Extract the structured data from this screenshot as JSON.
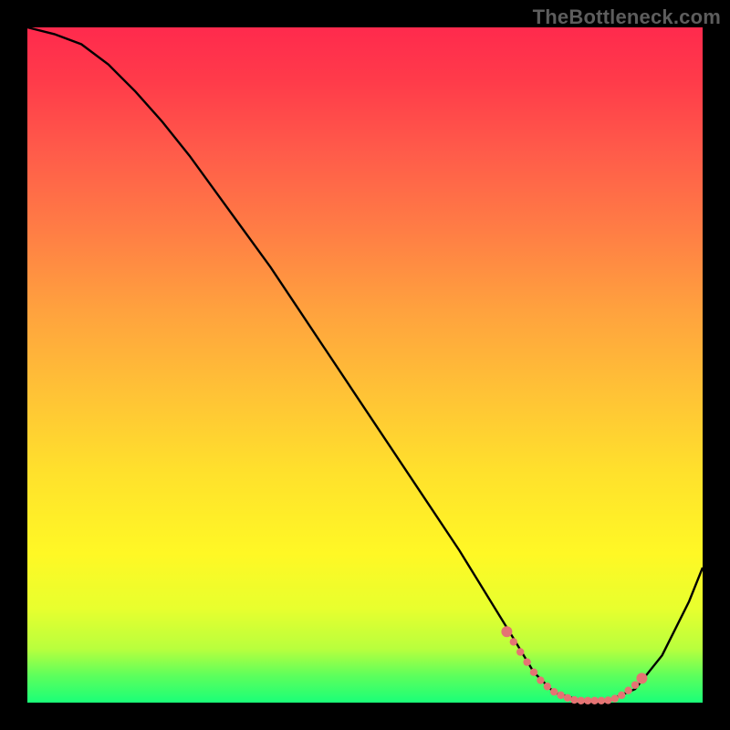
{
  "watermark": "TheBottleneck.com",
  "colors": {
    "frame": "#000000",
    "marker": "#e57373",
    "curve": "#000000",
    "gradient_top": "#ff2a4d",
    "gradient_bottom": "#1aff78"
  },
  "chart_data": {
    "type": "line",
    "title": "",
    "xlabel": "",
    "ylabel": "",
    "xlim": [
      0,
      100
    ],
    "ylim": [
      0,
      100
    ],
    "series": [
      {
        "name": "bottleneck-curve",
        "x": [
          0,
          4,
          8,
          12,
          16,
          20,
          24,
          28,
          32,
          36,
          40,
          44,
          48,
          52,
          56,
          60,
          64,
          68,
          72,
          75,
          78,
          82,
          86,
          90,
          94,
          98,
          100
        ],
        "y": [
          100,
          99,
          97.5,
          94.5,
          90.5,
          86,
          81,
          75.5,
          70,
          64.5,
          58.5,
          52.5,
          46.5,
          40.5,
          34.5,
          28.5,
          22.5,
          16,
          9.5,
          4.5,
          1.5,
          0.3,
          0.3,
          2,
          7,
          15,
          20
        ]
      }
    ],
    "markers": {
      "name": "highlight-range",
      "x": [
        71,
        72,
        73,
        74,
        75,
        76,
        77,
        78,
        79,
        80,
        81,
        82,
        83,
        84,
        85,
        86,
        87,
        88,
        89,
        90,
        91
      ],
      "y": [
        10.5,
        9,
        7.5,
        6,
        4.5,
        3.3,
        2.4,
        1.6,
        1.1,
        0.7,
        0.4,
        0.3,
        0.3,
        0.3,
        0.3,
        0.35,
        0.6,
        1.1,
        1.8,
        2.6,
        3.6
      ]
    }
  }
}
